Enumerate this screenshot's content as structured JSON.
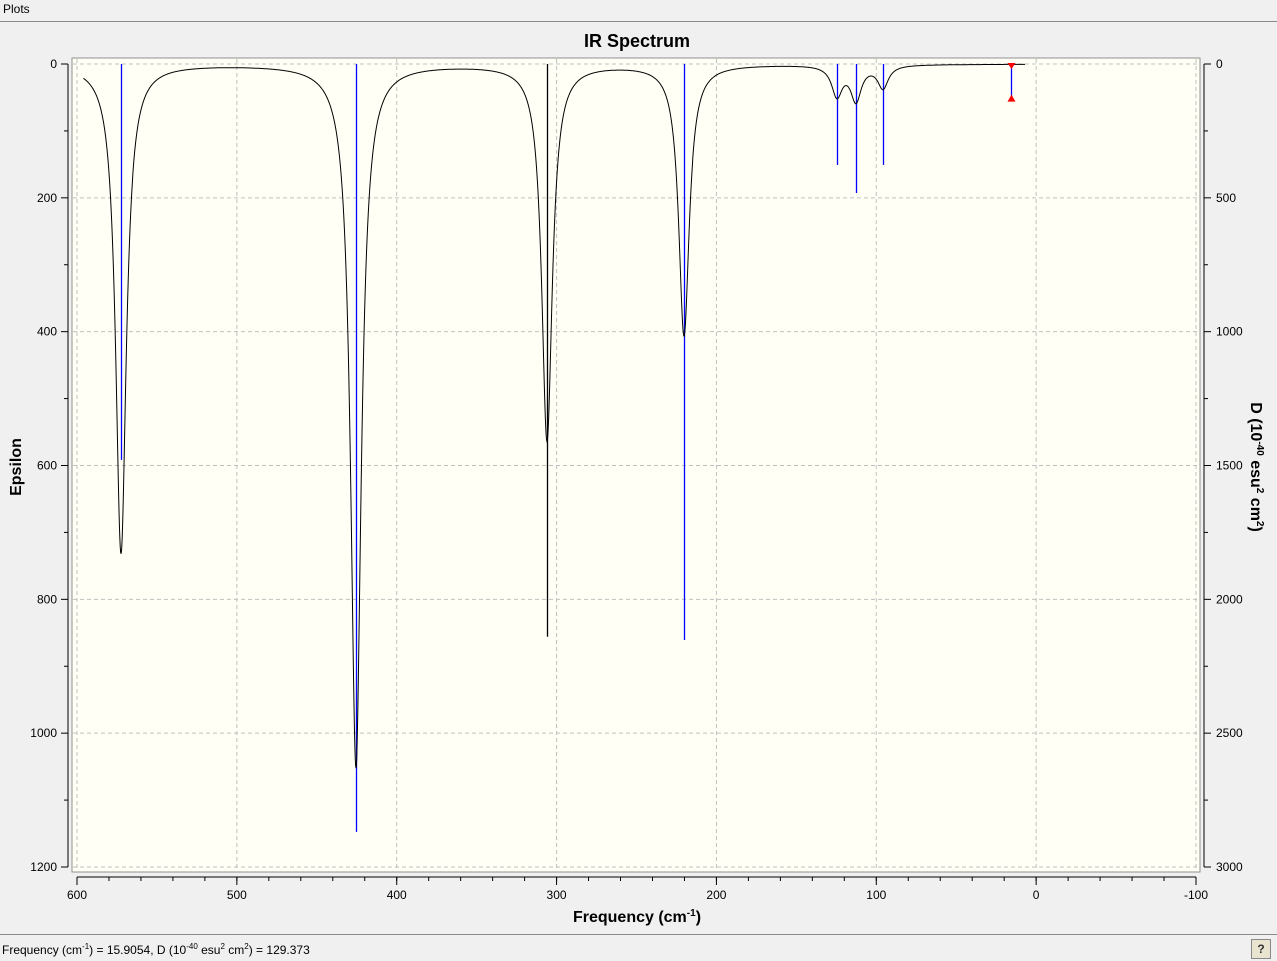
{
  "window": {
    "title": "Plots"
  },
  "status": {
    "prefix": "Frequency (cm",
    "freq_sup": "-1",
    "mid": ") = 15.9054, D (10",
    "d_sup": "-40",
    "mid2": " esu",
    "esu_sup": "2",
    "cm": " cm",
    "cm_sup": "2",
    "suffix": ") = 129.373"
  },
  "help_icon": "help-icon",
  "chart_data": {
    "type": "line",
    "title": "IR Spectrum",
    "xlabel": "Frequency (cm-1)",
    "xlabel_main": "Frequency (cm",
    "xlabel_sup": "-1",
    "ylabel": "Epsilon",
    "y2label_main": "D (10",
    "y2label_sup1": "-40",
    "y2label_mid": " esu",
    "y2label_sup2": "2",
    "y2label_cm": " cm",
    "y2label_sup3": "2",
    "xlim": [
      600,
      -100
    ],
    "ylim": [
      0,
      1200
    ],
    "y2lim": [
      0,
      3000
    ],
    "y_inverted": true,
    "grid": true,
    "x_ticks": [
      600,
      500,
      400,
      300,
      200,
      100,
      0,
      -100
    ],
    "y_ticks": [
      0,
      200,
      400,
      600,
      800,
      1000,
      1200
    ],
    "y2_ticks": [
      0,
      500,
      1000,
      1500,
      2000,
      2500,
      3000
    ],
    "curve_color": "#000000",
    "stick_color": "#0000ff",
    "marker_color": "#ff0000",
    "peaks": [
      {
        "freq": 572.5,
        "epsilon": 731,
        "D": 1479,
        "color": "#0000ff"
      },
      {
        "freq": 425.5,
        "epsilon": 1051,
        "D": 2869,
        "color": "#0000ff"
      },
      {
        "freq": 306.0,
        "epsilon": 562,
        "D": 2140,
        "color": "#000000"
      },
      {
        "freq": 220.3,
        "epsilon": 405,
        "D": 2152,
        "color": "#0000ff"
      },
      {
        "freq": 124.6,
        "epsilon": 45,
        "D": 377,
        "color": "#0000ff"
      },
      {
        "freq": 112.7,
        "epsilon": 52,
        "D": 482,
        "color": "#0000ff"
      },
      {
        "freq": 95.8,
        "epsilon": 34,
        "D": 377,
        "color": "#0000ff"
      }
    ],
    "selected_peak": {
      "freq": 15.9054,
      "D": 129.373
    },
    "curve_range": [
      596,
      7
    ]
  }
}
